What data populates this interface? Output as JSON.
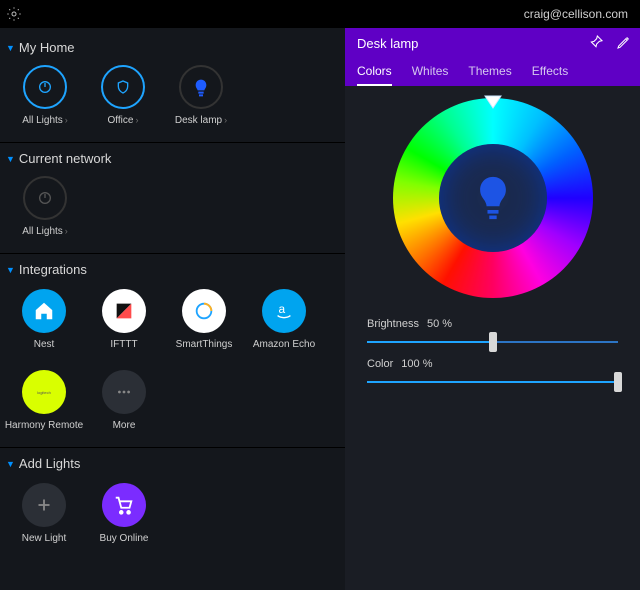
{
  "topbar": {
    "email": "craig@cellison.com"
  },
  "sidebar": {
    "sections": {
      "myhome": {
        "title": "My Home",
        "devices": [
          {
            "label": "All Lights",
            "ring": "blue",
            "icon": "power",
            "selected": false
          },
          {
            "label": "Office",
            "ring": "blue",
            "icon": "shield",
            "selected": false
          },
          {
            "label": "Desk lamp",
            "ring": "dim",
            "icon": "bulb-blue",
            "selected": true
          }
        ]
      },
      "network": {
        "title": "Current network",
        "devices": [
          {
            "label": "All Lights",
            "ring": "dim",
            "icon": "power",
            "selected": false
          }
        ]
      },
      "integrations": {
        "title": "Integrations",
        "items": [
          {
            "label": "Nest",
            "icon": "home",
            "bg": "#00a4ef",
            "fg": "#ffffff"
          },
          {
            "label": "IFTTT",
            "icon": "ifttt",
            "bg": "#ffffff",
            "fg": "#000000"
          },
          {
            "label": "SmartThings",
            "icon": "ring",
            "bg": "#ffffff",
            "fg": "#1ea4ff"
          },
          {
            "label": "Amazon Echo",
            "icon": "amazon",
            "bg": "#00a4ef",
            "fg": "#ffffff"
          },
          {
            "label": "Harmony Remote",
            "icon": "text-logitech",
            "bg": "#d9ff00",
            "fg": "#555555"
          },
          {
            "label": "More",
            "icon": "dots",
            "bg": "#2b2f36",
            "fg": "#888888"
          }
        ]
      },
      "addlights": {
        "title": "Add Lights",
        "items": [
          {
            "label": "New Light",
            "icon": "plus",
            "bg": "#2b2f36",
            "fg": "#888888"
          },
          {
            "label": "Buy Online",
            "icon": "cart",
            "bg": "#7b2cff",
            "fg": "#ffffff"
          }
        ]
      }
    }
  },
  "panel": {
    "title": "Desk lamp",
    "tabs": [
      "Colors",
      "Whites",
      "Themes",
      "Effects"
    ],
    "active_tab": 0,
    "brightness": {
      "label": "Brightness",
      "value": "50 %",
      "pct": 50
    },
    "color": {
      "label": "Color",
      "value": "100 %",
      "pct": 100
    }
  }
}
